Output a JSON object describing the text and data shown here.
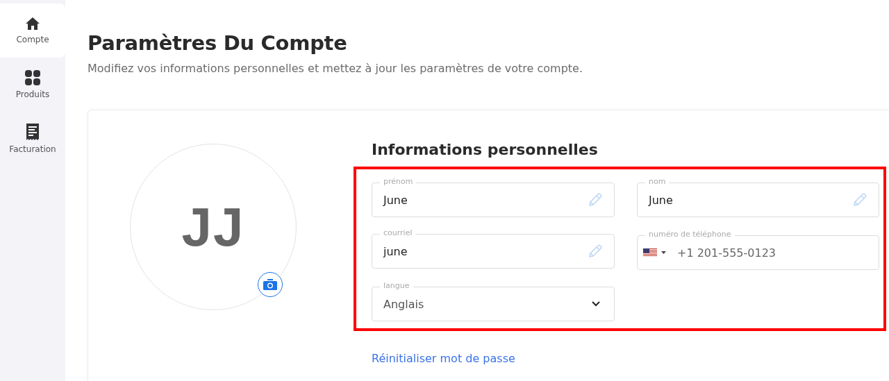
{
  "sidebar": {
    "items": [
      {
        "label": "Compte",
        "selected": true
      },
      {
        "label": "Produits",
        "selected": false
      },
      {
        "label": "Facturation",
        "selected": false
      }
    ]
  },
  "page": {
    "title": "Paramètres Du Compte",
    "subtitle": "Modifiez vos informations personnelles et mettez à jour les paramètres de votre compte."
  },
  "avatar": {
    "initials": "JJ"
  },
  "section": {
    "title": "Informations personnelles",
    "highlighted": true
  },
  "fields": [
    {
      "kind": "text",
      "label": "prénom",
      "value": "June"
    },
    {
      "kind": "text",
      "label": "nom",
      "value": "June"
    },
    {
      "kind": "text",
      "label": "courriel",
      "value": "june"
    },
    {
      "kind": "phone",
      "label": "numéro de téléphone",
      "placeholder": "+1 201-555-0123"
    },
    {
      "kind": "select",
      "label": "langue",
      "value": "Anglais"
    }
  ],
  "reset_link": "Réinitialiser mot de passe"
}
